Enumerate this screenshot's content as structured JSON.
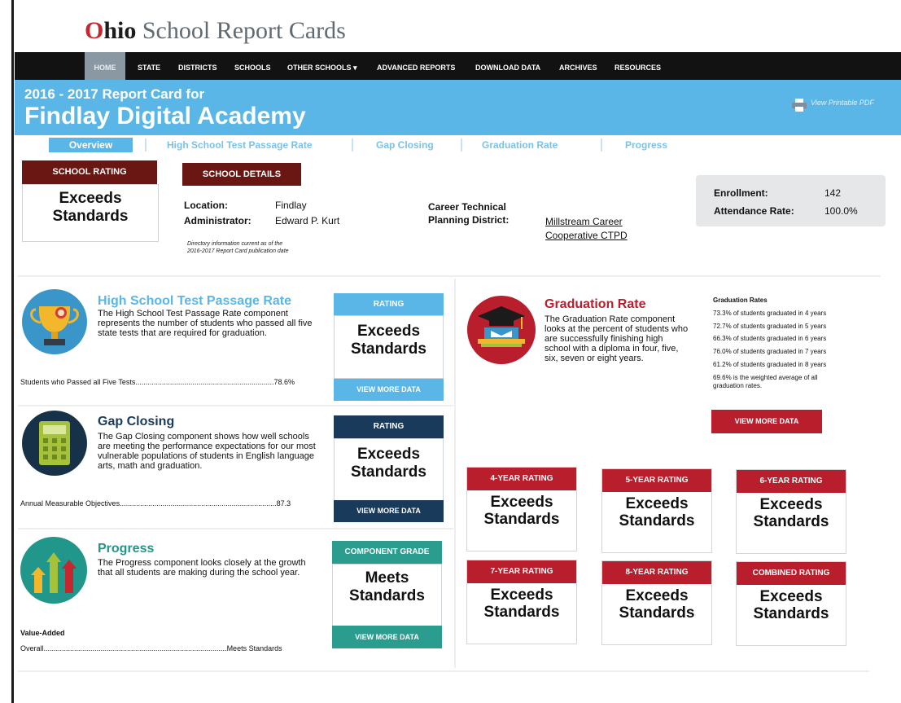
{
  "brand": {
    "first": "O",
    "rest_bold": "hio",
    "rest": " School Report Cards"
  },
  "nav": {
    "items": [
      "HOME",
      "STATE",
      "DISTRICTS",
      "SCHOOLS",
      "OTHER SCHOOLS",
      "ADVANCED REPORTS",
      "DOWNLOAD DATA",
      "ARCHIVES",
      "RESOURCES"
    ]
  },
  "banner": {
    "year": "2016 - 2017 Report Card for",
    "school": "Findlay Digital Academy",
    "printable": "View Printable PDF"
  },
  "tabs": [
    "Overview",
    "High School Test Passage Rate",
    "Gap Closing",
    "Graduation Rate",
    "Progress"
  ],
  "school_rating": {
    "label": "SCHOOL RATING",
    "value_line1": "Exceeds",
    "value_line2": "Standards"
  },
  "school_details": {
    "label": "SCHOOL DETAILS",
    "location_label": "Location:",
    "location_value": "Findlay",
    "admin_label": "Administrator:",
    "admin_value": "Edward P. Kurt",
    "ctpd_label1": "Career Technical",
    "ctpd_label2": "Planning District:",
    "ctpd_value1": "Millstream Career",
    "ctpd_value2": "Cooperative CTPD",
    "note1": "Directory information current as of the",
    "note2": "2016-2017 Report Card publication date"
  },
  "stats": {
    "enroll_label": "Enrollment:",
    "enroll_value": "142",
    "attend_label": "Attendance Rate:",
    "attend_value": "100.0%"
  },
  "hs_test": {
    "title": "High School Test Passage Rate",
    "desc": "The High School Test Passage Rate component represents the number of students who passed all five state tests that are required for graduation.",
    "metric_label": "Students who Passed all Five Tests",
    "metric_value": "78.6%",
    "rating_head": "RATING",
    "rating1": "Exceeds",
    "rating2": "Standards",
    "view_more": "VIEW MORE DATA"
  },
  "gap": {
    "title": "Gap Closing",
    "desc": "The Gap Closing component shows how well schools are meeting the performance expectations for our most vulnerable populations of students in English language arts, math and graduation.",
    "metric_label": "Annual Measurable Objectives",
    "metric_value": "87.3",
    "rating_head": "RATING",
    "rating1": "Exceeds",
    "rating2": "Standards",
    "view_more": "VIEW MORE DATA"
  },
  "progress": {
    "title": "Progress",
    "desc": "The Progress component looks closely at the growth that all students are making during the school year.",
    "va_label": "Value-Added",
    "metric_label": "Overall",
    "metric_value": "Meets Standards",
    "rating_head": "COMPONENT GRADE",
    "rating1": "Meets",
    "rating2": "Standards",
    "view_more": "VIEW MORE DATA"
  },
  "graduation": {
    "title": "Graduation Rate",
    "desc": "The Graduation Rate component looks at the percent of students who are successfully finishing high school with a diploma in four, five, six, seven or eight years.",
    "rates_title": "Graduation Rates",
    "rates": [
      "73.3% of students graduated in 4 years",
      "72.7% of students graduated in 5 years",
      "66.3% of students graduated in 6 years",
      "76.0% of students graduated in 7 years",
      "61.2% of students graduated in 8 years",
      "69.6% is the weighted average of all",
      "graduation rates."
    ],
    "view_more": "VIEW MORE DATA",
    "cards": [
      {
        "head": "4-YEAR RATING",
        "r1": "Exceeds",
        "r2": "Standards"
      },
      {
        "head": "5-YEAR RATING",
        "r1": "Exceeds",
        "r2": "Standards"
      },
      {
        "head": "6-YEAR RATING",
        "r1": "Exceeds",
        "r2": "Standards"
      },
      {
        "head": "7-YEAR RATING",
        "r1": "Exceeds",
        "r2": "Standards"
      },
      {
        "head": "8-YEAR RATING",
        "r1": "Exceeds",
        "r2": "Standards"
      },
      {
        "head": "COMBINED RATING",
        "r1": "Exceeds",
        "r2": "Standards"
      }
    ]
  },
  "icons": {
    "trophy": "trophy-icon",
    "calculator": "calculator-icon",
    "progress": "bar-arrows-icon",
    "graduation": "graduation-cap-icon",
    "printer": "printer-icon"
  },
  "colors": {
    "brand_red": "#c4272d",
    "banner_blue": "#5bb6e8",
    "navy": "#1a3a5c",
    "teal": "#2a9d8f",
    "dark_red": "#6a1612",
    "grad_red": "#b81e2c"
  }
}
